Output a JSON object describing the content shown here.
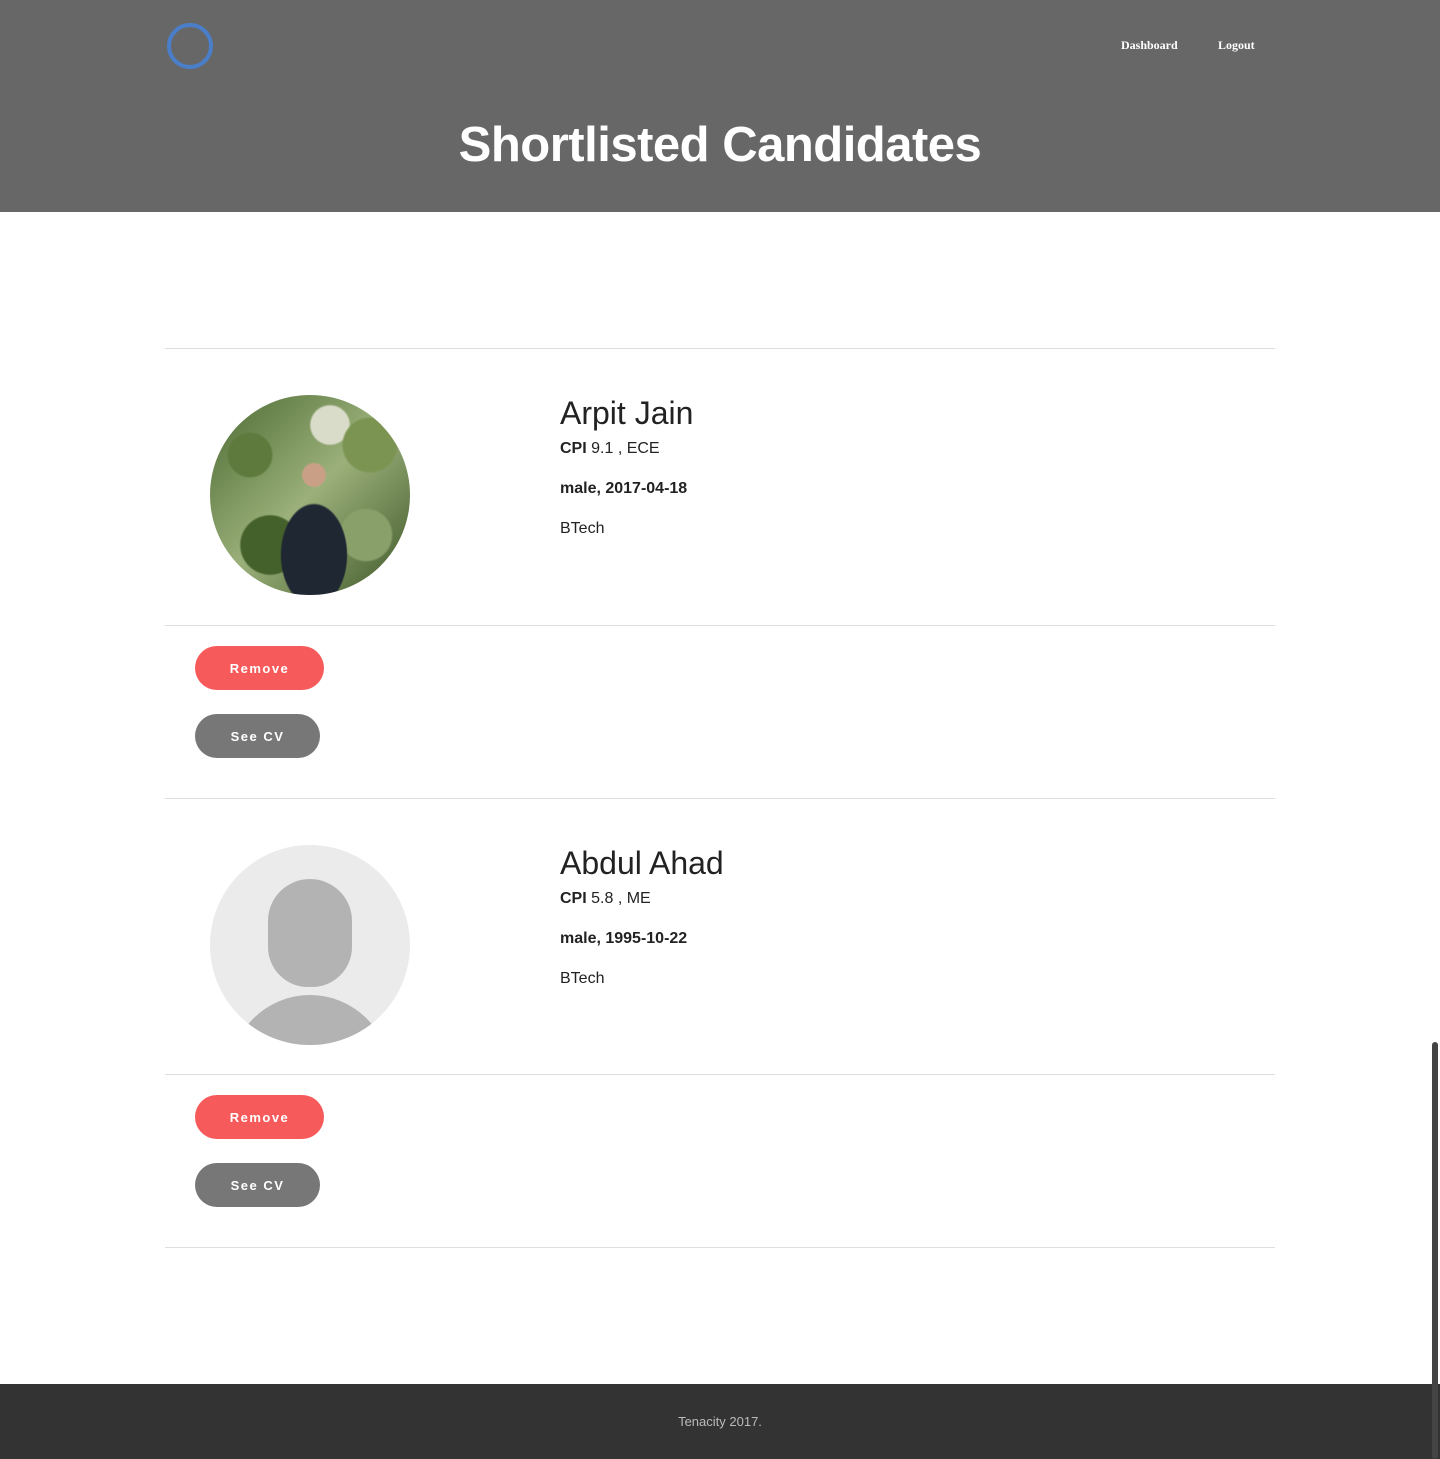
{
  "header": {
    "nav": {
      "dashboard": "Dashboard",
      "logout": "Logout"
    },
    "title": "Shortlisted Candidates"
  },
  "candidates": [
    {
      "name": "Arpit Jain",
      "cpi_label": "CPI",
      "cpi_value": "9.1 , ECE",
      "gender_dob": "male, 2017-04-18",
      "degree": "BTech",
      "avatar": "candidate-photo",
      "remove_label": "Remove",
      "cv_label": "See CV"
    },
    {
      "name": "Abdul Ahad",
      "cpi_label": "CPI",
      "cpi_value": "5.8 , ME",
      "gender_dob": "male, 1995-10-22",
      "degree": "BTech",
      "avatar": "default-avatar-icon",
      "remove_label": "Remove",
      "cv_label": "See CV"
    }
  ],
  "footer": {
    "text": "Tenacity 2017."
  },
  "colors": {
    "header_bg": "#676767",
    "logo_ring": "#4a7ec9",
    "remove_button": "#f75a5a",
    "cv_button": "#777777",
    "footer_bg": "#333333"
  }
}
